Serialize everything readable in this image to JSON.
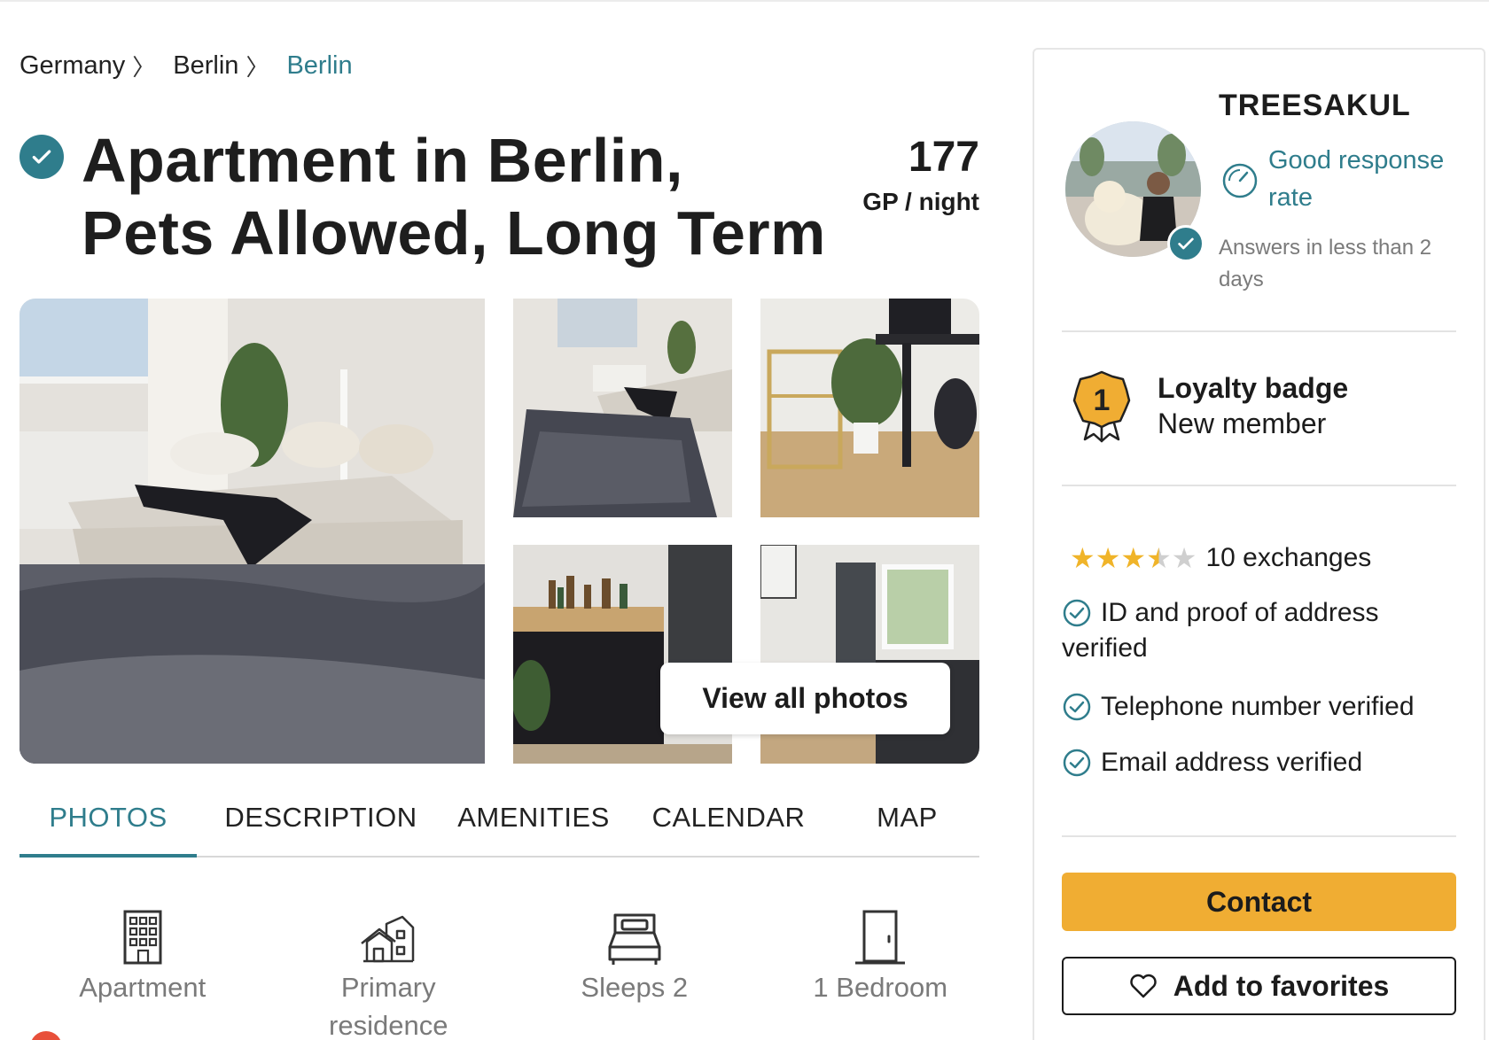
{
  "breadcrumb": [
    {
      "label": "Germany"
    },
    {
      "label": "Berlin"
    },
    {
      "label": "Berlin"
    }
  ],
  "breadcrumb_separator": "〉",
  "listing": {
    "title_line1": "Apartment in Berlin,",
    "title_line2": "Pets Allowed, Long Term",
    "price_value": "177",
    "price_unit": "GP / night"
  },
  "gallery": {
    "view_all_label": "View all photos",
    "photo_count_shown": 5
  },
  "tabs": [
    {
      "label": "PHOTOS",
      "active": true
    },
    {
      "label": "DESCRIPTION",
      "active": false
    },
    {
      "label": "AMENITIES",
      "active": false
    },
    {
      "label": "CALENDAR",
      "active": false
    },
    {
      "label": "MAP",
      "active": false
    }
  ],
  "features": [
    {
      "icon": "building-icon",
      "label": "Apartment"
    },
    {
      "icon": "house-icon",
      "label": "Primary residence"
    },
    {
      "icon": "bed-icon",
      "label": "Sleeps 2"
    },
    {
      "icon": "door-icon",
      "label": "1 Bedroom"
    }
  ],
  "host": {
    "name": "TREESAKUL",
    "response_label": "Good response rate",
    "answers_text": "Answers in less than 2 days",
    "loyalty_title": "Loyalty badge",
    "loyalty_subtitle": "New member",
    "loyalty_badge_number": "1",
    "rating_stars": 3.5,
    "exchanges": "10 exchanges",
    "verifications": [
      "ID and proof of address verified",
      "Telephone number verified",
      "Email address verified"
    ],
    "contact_label": "Contact",
    "favorites_label": "Add to favorites"
  },
  "colors": {
    "accent": "#2f7d8c",
    "contact_button": "#f0ad33",
    "star": "#f0b429",
    "muted_text": "#7a7a7a"
  }
}
